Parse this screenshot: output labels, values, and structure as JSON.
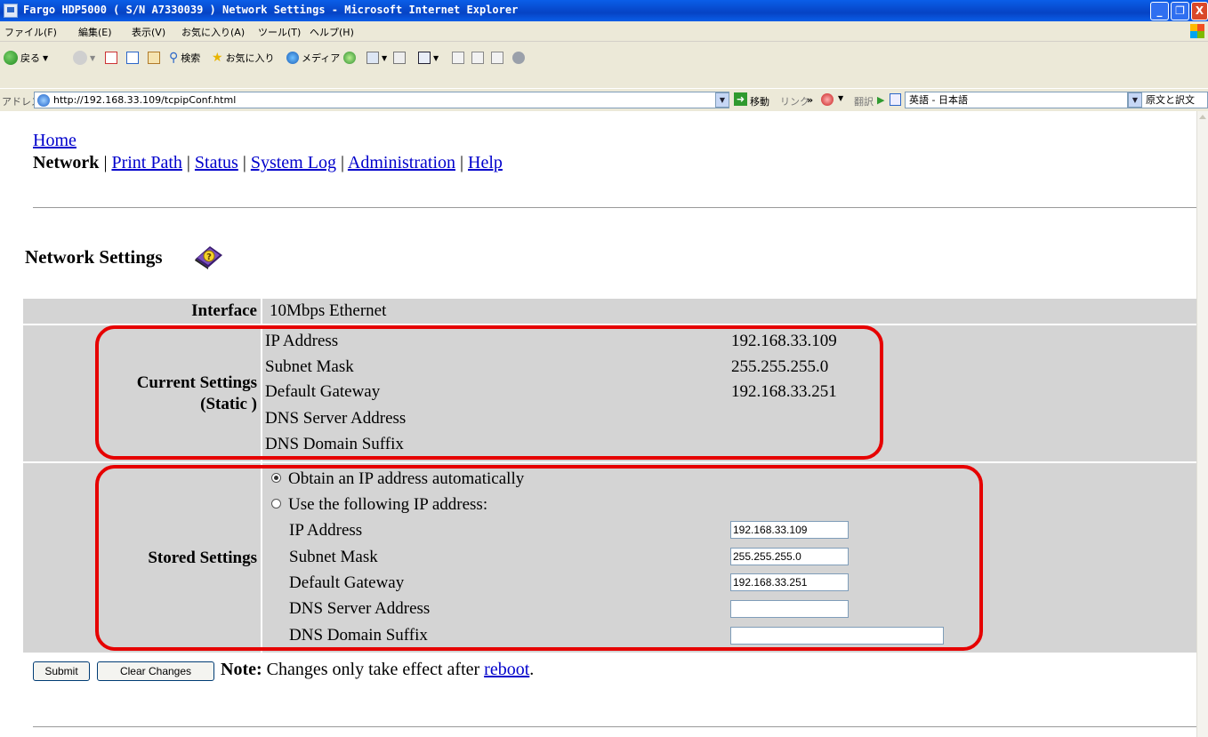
{
  "window": {
    "title": "Fargo HDP5000 ( S/N A7330039 ) Network Settings - Microsoft Internet Explorer",
    "min": "_",
    "max": "❐",
    "close": "X"
  },
  "menubar": [
    "ファイル(F)",
    "編集(E)",
    "表示(V)",
    "お気に入り(A)",
    "ツール(T)",
    "ヘルプ(H)"
  ],
  "toolbar": {
    "back": "戻る",
    "search": "検索",
    "favorites": "お気に入り",
    "media": "メディア"
  },
  "addressbar": {
    "label": "アドレス(D)",
    "url": "http://192.168.33.109/tcpipConf.html",
    "go": "移動",
    "links": "リンク",
    "chevron": "»",
    "translate": "翻訳",
    "language": "英語 - 日本語",
    "mode": "原文と訳文"
  },
  "nav": {
    "home": "Home",
    "current": "Network",
    "sep": "|",
    "links": [
      "Print Path",
      "Status",
      "System Log",
      "Administration",
      "Help"
    ]
  },
  "page": {
    "title": "Network Settings",
    "help_icon": "help-book-icon"
  },
  "interface": {
    "label": "Interface",
    "value": "10Mbps Ethernet"
  },
  "current_settings": {
    "label_line1": "Current Settings",
    "label_line2": "(Static )",
    "fields": [
      {
        "label": "IP Address",
        "value": "192.168.33.109"
      },
      {
        "label": "Subnet Mask",
        "value": "255.255.255.0"
      },
      {
        "label": "Default Gateway",
        "value": "192.168.33.251"
      },
      {
        "label": "DNS Server Address",
        "value": ""
      },
      {
        "label": "DNS Domain Suffix",
        "value": ""
      }
    ]
  },
  "stored_settings": {
    "label": "Stored Settings",
    "radio_auto": "Obtain an IP address automatically",
    "radio_auto_selected": true,
    "radio_static": "Use the following IP address:",
    "fields": [
      {
        "label": "IP Address",
        "value": "192.168.33.109"
      },
      {
        "label": "Subnet Mask",
        "value": "255.255.255.0"
      },
      {
        "label": "Default Gateway",
        "value": "192.168.33.251"
      },
      {
        "label": "DNS Server Address",
        "value": ""
      },
      {
        "label": "DNS Domain Suffix",
        "value": ""
      }
    ]
  },
  "actions": {
    "submit": "Submit",
    "clear": "Clear Changes",
    "note_bold": "Note:",
    "note_text": "Changes only take effect after",
    "note_link": "reboot",
    "note_end": "."
  },
  "colors": {
    "highlight_box": "#e60000",
    "table_bg": "#d4d4d4",
    "link": "#0000cc"
  }
}
